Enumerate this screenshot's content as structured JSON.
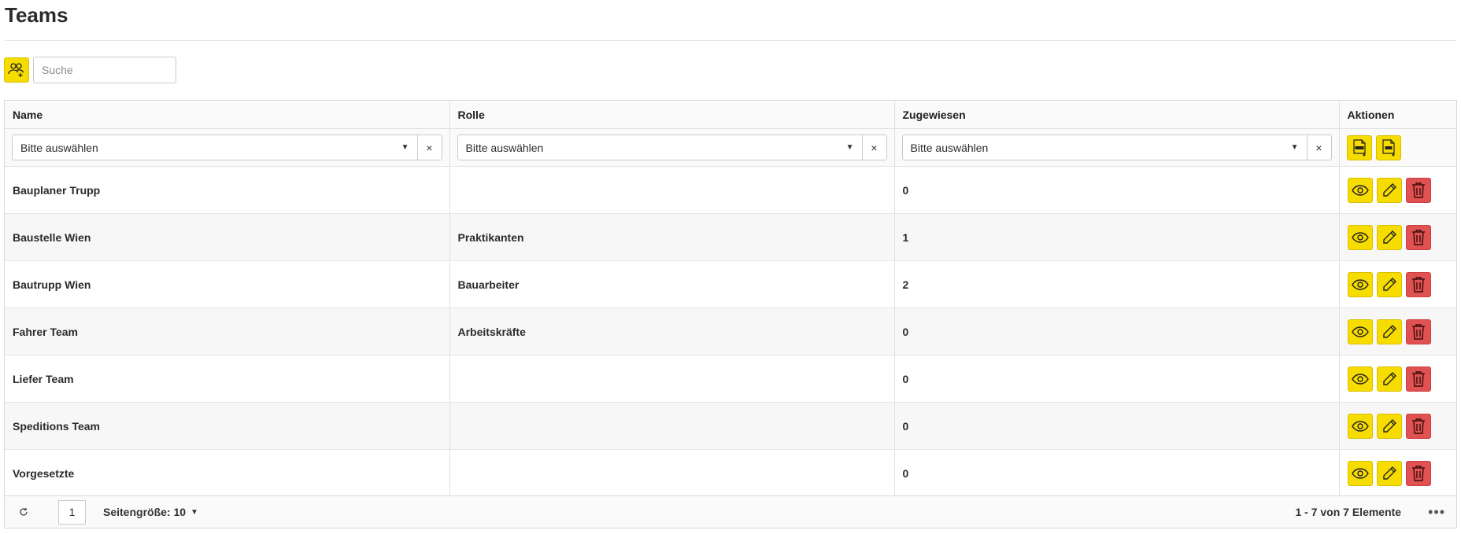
{
  "page": {
    "title": "Teams"
  },
  "toolbar": {
    "search_placeholder": "Suche",
    "add_team_icon": "users-add-icon"
  },
  "table": {
    "columns": [
      "Name",
      "Rolle",
      "Zugewiesen",
      "Aktionen"
    ],
    "filter_placeholder": "Bitte auswählen",
    "filter_clear": "×",
    "rows": [
      {
        "name": "Bauplaner Trupp",
        "rolle": "",
        "zugewiesen": "0"
      },
      {
        "name": "Baustelle Wien",
        "rolle": "Praktikanten",
        "zugewiesen": "1"
      },
      {
        "name": "Bautrupp Wien",
        "rolle": "Bauarbeiter",
        "zugewiesen": "2"
      },
      {
        "name": "Fahrer Team",
        "rolle": "Arbeitskräfte",
        "zugewiesen": "0"
      },
      {
        "name": "Liefer Team",
        "rolle": "",
        "zugewiesen": "0"
      },
      {
        "name": "Speditions Team",
        "rolle": "",
        "zugewiesen": "0"
      },
      {
        "name": "Vorgesetzte",
        "rolle": "",
        "zugewiesen": "0"
      }
    ]
  },
  "pager": {
    "page": "1",
    "page_size_label": "Seitengröße: 10",
    "info": "1 - 7 von 7 Elemente",
    "more": "•••"
  },
  "colors": {
    "accent_yellow": "#f7dc00",
    "danger_red": "#e05252"
  }
}
